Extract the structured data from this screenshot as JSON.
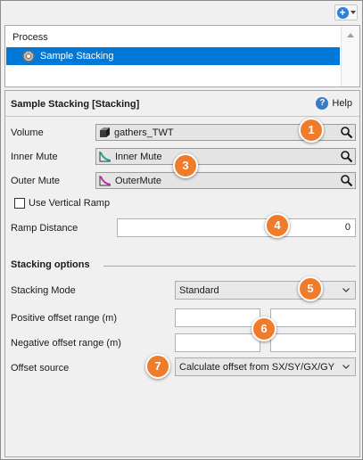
{
  "toolbar": {
    "add_icon_glyph": "+"
  },
  "process_panel": {
    "title": "Process",
    "selected_item": "Sample Stacking"
  },
  "properties": {
    "title": "Sample Stacking [Stacking]",
    "help_label": "Help",
    "volume": {
      "label": "Volume",
      "value": "gathers_TWT"
    },
    "inner_mute": {
      "label": "Inner Mute",
      "value": "Inner Mute"
    },
    "outer_mute": {
      "label": "Outer Mute",
      "value": "OuterMute"
    },
    "use_vertical_ramp": {
      "label": "Use Vertical Ramp",
      "checked": false
    },
    "ramp_distance": {
      "label": "Ramp Distance",
      "value": "0"
    },
    "stacking_options": {
      "title": "Stacking options",
      "stacking_mode": {
        "label": "Stacking Mode",
        "value": "Standard"
      },
      "positive_offset": {
        "label": "Positive offset range (m)",
        "min": "",
        "max": ""
      },
      "negative_offset": {
        "label": "Negative offset range (m)",
        "min": "",
        "max": ""
      },
      "offset_source": {
        "label": "Offset source",
        "value": "Calculate offset from SX/SY/GX/GY"
      }
    }
  },
  "callouts": [
    "1",
    "3",
    "4",
    "5",
    "6",
    "7"
  ],
  "colors": {
    "selection": "#0078d7",
    "callout": "#ef7c2b",
    "help_icon": "#3d7ac2"
  }
}
